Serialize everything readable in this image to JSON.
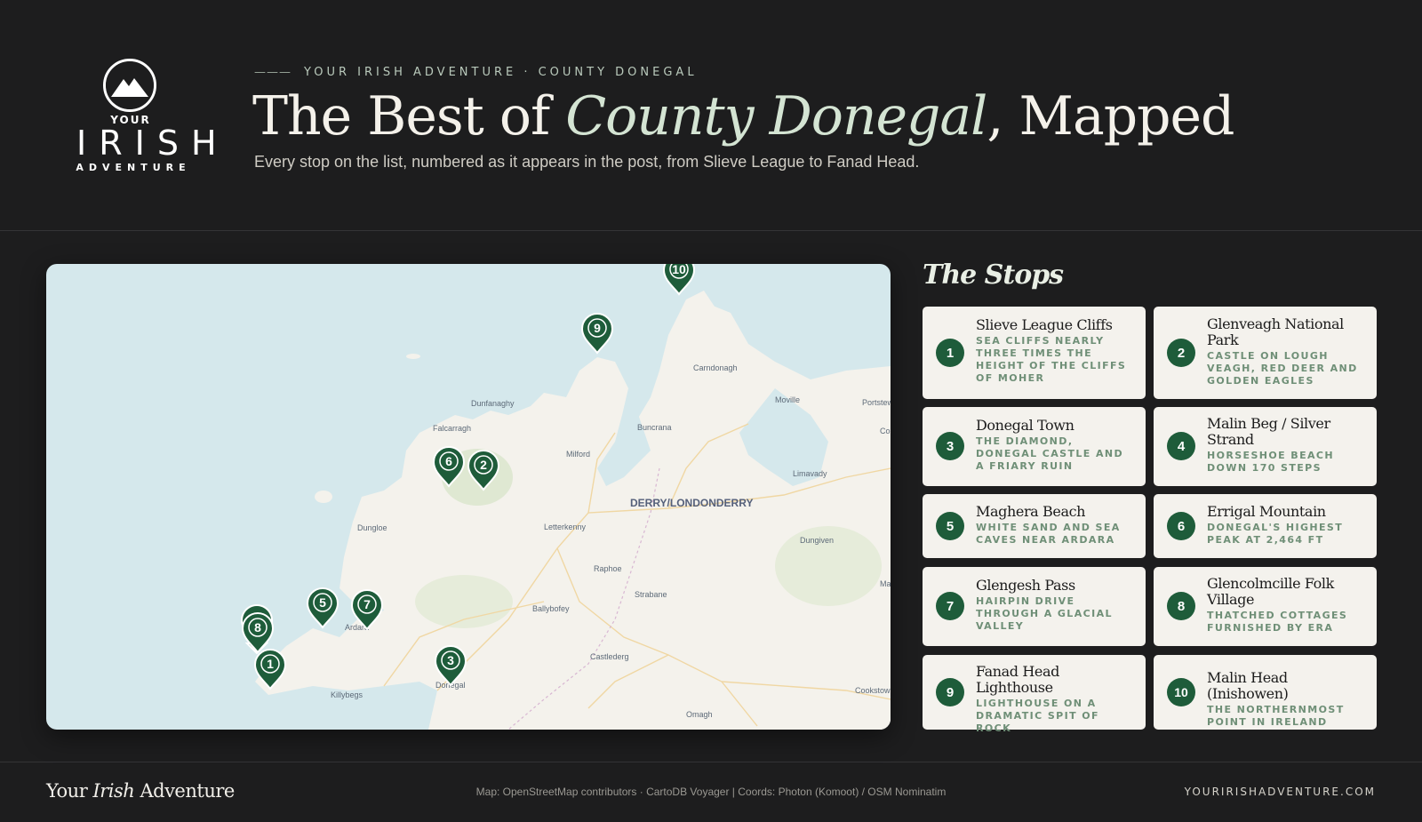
{
  "brand": {
    "logo_line1": "YOUR",
    "logo_line2": "IRISH",
    "logo_line3": "ADVENTURE",
    "logo_icon": "mountain-icon"
  },
  "header": {
    "eyebrow_rule": "———",
    "eyebrow": "YOUR IRISH ADVENTURE · COUNTY DONEGAL",
    "title_pre": "The Best of ",
    "title_em": "County Donegal",
    "title_post": ", Mapped",
    "subtitle": "Every stop on the list, numbered as it appears in the post, from Slieve League to Fanad Head."
  },
  "map": {
    "colors": {
      "sea": "#d5e8ec",
      "land": "#f4f2ec",
      "park": "#dfe8d2",
      "pin": "#1e5c3a",
      "road": "#f0d7a3"
    },
    "places": [
      "Carndonagh",
      "Moville",
      "Portstew",
      "Col",
      "Dunfanaghy",
      "Falcarragh",
      "Buncrana",
      "Milford",
      "Limavady",
      "DERRY/LONDONDERRY",
      "Dungloe",
      "Letterkenny",
      "Dungiven",
      "Raphoe",
      "Ma",
      "Strabane",
      "Ballybofey",
      "Ardara",
      "Castlederg",
      "Killybegs",
      "Donegal",
      "Cookstow",
      "Omagh"
    ],
    "pins": [
      "1",
      "2",
      "3",
      "4",
      "5",
      "6",
      "7",
      "8",
      "9",
      "10"
    ]
  },
  "stops": {
    "heading": "The Stops",
    "items": [
      {
        "num": "1",
        "name": "Slieve League Cliffs",
        "desc": "Sea cliffs nearly three times the height of the Cliffs of Moher"
      },
      {
        "num": "2",
        "name": "Glenveagh National Park",
        "desc": "Castle on Lough Veagh, red deer and golden eagles"
      },
      {
        "num": "3",
        "name": "Donegal Town",
        "desc": "The Diamond, Donegal Castle and a friary ruin"
      },
      {
        "num": "4",
        "name": "Malin Beg / Silver Strand",
        "desc": "Horseshoe beach down 170 steps"
      },
      {
        "num": "5",
        "name": "Maghera Beach",
        "desc": "White sand and sea caves near Ardara"
      },
      {
        "num": "6",
        "name": "Errigal Mountain",
        "desc": "Donegal's highest peak at 2,464 ft"
      },
      {
        "num": "7",
        "name": "Glengesh Pass",
        "desc": "Hairpin drive through a glacial valley"
      },
      {
        "num": "8",
        "name": "Glencolmcille Folk Village",
        "desc": "Thatched cottages furnished by era"
      },
      {
        "num": "9",
        "name": "Fanad Head Lighthouse",
        "desc": "Lighthouse on a dramatic spit of rock"
      },
      {
        "num": "10",
        "name": "Malin Head (Inishowen)",
        "desc": "The northernmost point in Ireland"
      }
    ]
  },
  "footer": {
    "brand_pre": "Your ",
    "brand_em": "Irish",
    "brand_post": " Adventure",
    "credit": "Map: OpenStreetMap contributors · CartoDB Voyager | Coords: Photon (Komoot) / OSM Nominatim",
    "url": "YOURIRISHADVENTURE.COM"
  }
}
